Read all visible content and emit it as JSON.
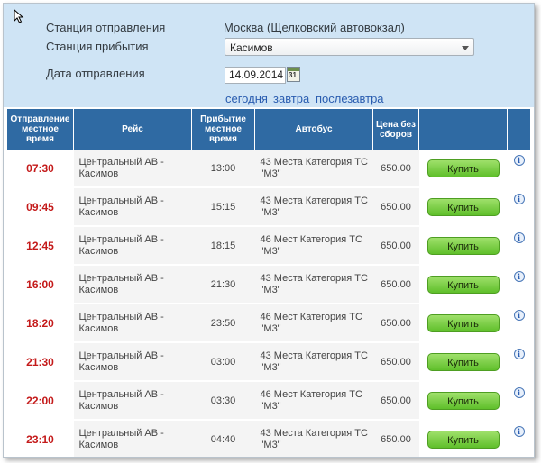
{
  "form": {
    "departure_label": "Станция отправления",
    "departure_value": "Москва (Щелковский автовокзал)",
    "arrival_label": "Станция прибытия",
    "arrival_value": "Касимов",
    "date_label": "Дата отправления",
    "date_value": "14.09.2014",
    "calendar_icon_text": "31",
    "quick_links": [
      "сегодня",
      "завтра",
      "послезавтра"
    ]
  },
  "table": {
    "headers": {
      "departure": "Отправление местное время",
      "route": "Рейс",
      "arrival": "Прибытие местное время",
      "bus": "Автобус",
      "price": "Цена без сборов"
    },
    "buy_label": "Купить",
    "rows": [
      {
        "time": "07:30",
        "route": "Центральный АВ - Касимов",
        "arrival": "13:00",
        "bus": "43 Места Категория ТС \"М3\"",
        "price": "650.00"
      },
      {
        "time": "09:45",
        "route": "Центральный АВ - Касимов",
        "arrival": "15:15",
        "bus": "43 Места Категория ТС \"М3\"",
        "price": "650.00"
      },
      {
        "time": "12:45",
        "route": "Центральный АВ - Касимов",
        "arrival": "18:15",
        "bus": "46 Мест Категория ТС \"М3\"",
        "price": "650.00"
      },
      {
        "time": "16:00",
        "route": "Центральный АВ - Касимов",
        "arrival": "21:30",
        "bus": "43 Места Категория ТС \"М3\"",
        "price": "650.00"
      },
      {
        "time": "18:20",
        "route": "Центральный АВ - Касимов",
        "arrival": "23:50",
        "bus": "46 Мест Категория ТС \"М3\"",
        "price": "650.00"
      },
      {
        "time": "21:30",
        "route": "Центральный АВ - Касимов",
        "arrival": "03:00",
        "bus": "43 Места Категория ТС \"М3\"",
        "price": "650.00"
      },
      {
        "time": "22:00",
        "route": "Центральный АВ - Касимов",
        "arrival": "03:30",
        "bus": "46 Мест Категория ТС \"М3\"",
        "price": "650.00"
      },
      {
        "time": "23:10",
        "route": "Центральный АВ - Касимов",
        "arrival": "04:40",
        "bus": "43 Места Категория ТС \"М3\"",
        "price": "650.00"
      }
    ]
  },
  "colors": {
    "form_bg": "#cfe4f5",
    "header_bg": "#2f6aa3",
    "time_red": "#c41a1a",
    "buy_green": "#5fbf2a",
    "link_blue": "#2a5db0"
  },
  "icons": {
    "cursor": "mouse-pointer-icon",
    "select_arrow": "chevron-down-icon",
    "calendar": "calendar-icon",
    "info": "info-icon"
  }
}
